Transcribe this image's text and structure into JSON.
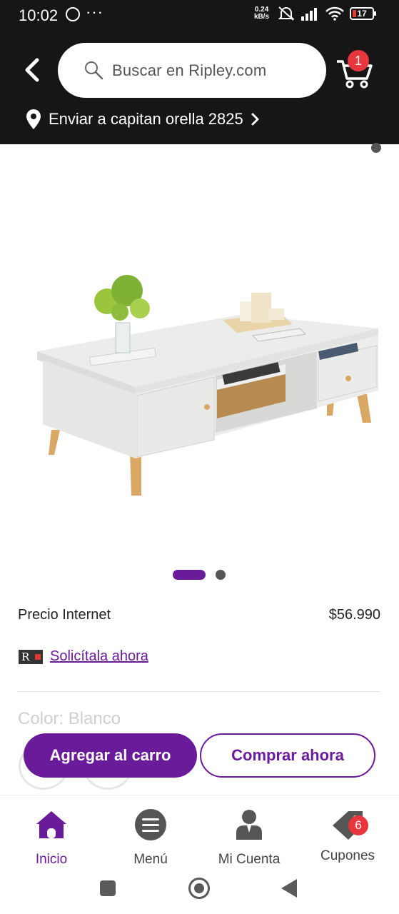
{
  "status_bar": {
    "time": "10:02",
    "speed_value": "0.24",
    "speed_unit": "kB/s",
    "battery": "17"
  },
  "header": {
    "search_placeholder": "Buscar en Ripley.com",
    "cart_count": "1",
    "ship_to": "Enviar a capitan orella 2825"
  },
  "gallery": {
    "slides": 2,
    "active_slide": 1
  },
  "product": {
    "price_label": "Precio Internet",
    "price": "$56.990",
    "credit_link": "Solicítala ahora",
    "color_label": "Color: Blanco"
  },
  "actions": {
    "add_to_cart": "Agregar al carro",
    "buy_now": "Comprar ahora"
  },
  "bottom_nav": {
    "items": [
      {
        "label": "Inicio",
        "icon": "home-icon"
      },
      {
        "label": "Menú",
        "icon": "menu-icon"
      },
      {
        "label": "Mi Cuenta",
        "icon": "account-icon"
      },
      {
        "label": "Cupones",
        "icon": "coupon-icon"
      }
    ],
    "coupon_count": "6"
  },
  "colors": {
    "brand_purple": "#6a1b9a",
    "header_bg": "#161616",
    "badge_red": "#e8363f"
  }
}
